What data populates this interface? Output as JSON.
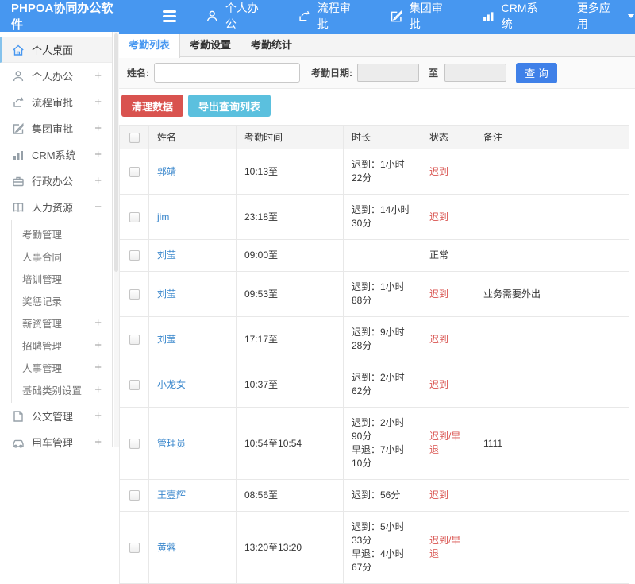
{
  "topbar": {
    "brand": "PHPOA协同办公软件",
    "nav": [
      {
        "label": "个人办公",
        "icon": "person-icon"
      },
      {
        "label": "流程审批",
        "icon": "workflow-icon"
      },
      {
        "label": "集团审批",
        "icon": "edit-icon"
      },
      {
        "label": "CRM系统",
        "icon": "bar-chart-icon"
      },
      {
        "label": "更多应用",
        "icon": "caret-down-icon"
      }
    ]
  },
  "sidebar": {
    "items": [
      {
        "label": "个人桌面",
        "icon": "home-icon",
        "toggle": "",
        "active": true
      },
      {
        "label": "个人办公",
        "icon": "person-icon",
        "toggle": "+"
      },
      {
        "label": "流程审批",
        "icon": "workflow-icon",
        "toggle": "+"
      },
      {
        "label": "集团审批",
        "icon": "edit-icon",
        "toggle": "+"
      },
      {
        "label": "CRM系统",
        "icon": "bar-chart-icon",
        "toggle": "+"
      },
      {
        "label": "行政办公",
        "icon": "briefcase-icon",
        "toggle": "+"
      },
      {
        "label": "人力资源",
        "icon": "book-icon",
        "toggle": "−",
        "expanded": true,
        "children": [
          {
            "label": "考勤管理",
            "toggle": ""
          },
          {
            "label": "人事合同",
            "toggle": ""
          },
          {
            "label": "培训管理",
            "toggle": ""
          },
          {
            "label": "奖惩记录",
            "toggle": ""
          },
          {
            "label": "薪资管理",
            "toggle": "+"
          },
          {
            "label": "招聘管理",
            "toggle": "+"
          },
          {
            "label": "人事管理",
            "toggle": "+"
          },
          {
            "label": "基础类别设置",
            "toggle": "+"
          }
        ]
      },
      {
        "label": "公文管理",
        "icon": "document-icon",
        "toggle": "+"
      },
      {
        "label": "用车管理",
        "icon": "car-icon",
        "toggle": "+"
      }
    ]
  },
  "tabs": [
    {
      "label": "考勤列表",
      "active": true
    },
    {
      "label": "考勤设置",
      "active": false
    },
    {
      "label": "考勤统计",
      "active": false
    }
  ],
  "filter": {
    "name_label": "姓名:",
    "name_value": "",
    "date_label": "考勤日期:",
    "date_from": "",
    "to_label": "至",
    "date_to": "",
    "query_button": "查 询"
  },
  "actions": {
    "clear_button": "清理数据",
    "export_button": "导出查询列表"
  },
  "table": {
    "columns": [
      "姓名",
      "考勤时间",
      "时长",
      "状态",
      "备注"
    ],
    "rows": [
      {
        "name": "郭靖",
        "time": "10:13至",
        "duration1": "迟到：1小时22分",
        "duration2": "",
        "status": "迟到",
        "status_alert": true,
        "note": ""
      },
      {
        "name": "jim",
        "time": "23:18至",
        "duration1": "迟到：14小时30分",
        "duration2": "",
        "status": "迟到",
        "status_alert": true,
        "note": ""
      },
      {
        "name": "刘莹",
        "time": "09:00至",
        "duration1": "",
        "duration2": "",
        "status": "正常",
        "status_alert": false,
        "note": ""
      },
      {
        "name": "刘莹",
        "time": "09:53至",
        "duration1": "迟到：1小时88分",
        "duration2": "",
        "status": "迟到",
        "status_alert": true,
        "note": "业务需要外出"
      },
      {
        "name": "刘莹",
        "time": "17:17至",
        "duration1": "迟到：9小时28分",
        "duration2": "",
        "status": "迟到",
        "status_alert": true,
        "note": ""
      },
      {
        "name": "小龙女",
        "time": "10:37至",
        "duration1": "迟到：2小时62分",
        "duration2": "",
        "status": "迟到",
        "status_alert": true,
        "note": ""
      },
      {
        "name": "管理员",
        "time": "10:54至10:54",
        "duration1": "迟到：2小时90分",
        "duration2": "早退：7小时10分",
        "status": "迟到/早退",
        "status_alert": true,
        "note": "1111"
      },
      {
        "name": "王壹辉",
        "time": "08:56至",
        "duration1": "迟到：56分",
        "duration2": "",
        "status": "迟到",
        "status_alert": true,
        "note": ""
      },
      {
        "name": "黄蓉",
        "time": "13:20至13:20",
        "duration1": "迟到：5小时33分",
        "duration2": "早退：4小时67分",
        "status": "迟到/早退",
        "status_alert": true,
        "note": ""
      }
    ]
  },
  "colors": {
    "topbar_blue": "#4797f0",
    "active_item_border": "#84c2ec",
    "link_blue": "#3a87cc",
    "alert_red": "#d9534f",
    "danger_button": "#d9534f",
    "info_button": "#5bc0de",
    "query_button": "#3f80e8"
  }
}
